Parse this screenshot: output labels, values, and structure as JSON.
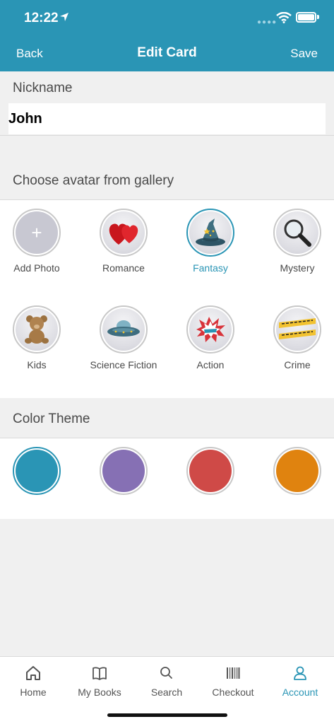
{
  "status_bar": {
    "time": "12:22"
  },
  "nav": {
    "back_label": "Back",
    "title": "Edit Card",
    "save_label": "Save"
  },
  "nickname": {
    "label": "Nickname",
    "value": "John"
  },
  "gallery": {
    "label": "Choose avatar from gallery",
    "items": [
      {
        "label": "Add Photo",
        "icon": "plus-icon"
      },
      {
        "label": "Romance",
        "icon": "hearts-icon"
      },
      {
        "label": "Fantasy",
        "icon": "wizard-hat-icon",
        "selected": true
      },
      {
        "label": "Mystery",
        "icon": "magnifier-icon"
      },
      {
        "label": "Kids",
        "icon": "teddy-bear-icon"
      },
      {
        "label": "Science Fiction",
        "icon": "ufo-icon"
      },
      {
        "label": "Action",
        "icon": "boom-icon"
      },
      {
        "label": "Crime",
        "icon": "crime-tape-icon"
      }
    ]
  },
  "color_theme": {
    "label": "Color Theme",
    "colors": [
      "#2a95b5",
      "#8670b4",
      "#cf4a47",
      "#e0830f"
    ],
    "selected_index": 0
  },
  "tabbar": {
    "tabs": [
      {
        "label": "Home",
        "icon": "home-icon"
      },
      {
        "label": "My Books",
        "icon": "book-icon"
      },
      {
        "label": "Search",
        "icon": "search-icon"
      },
      {
        "label": "Checkout",
        "icon": "barcode-icon"
      },
      {
        "label": "Account",
        "icon": "account-icon",
        "active": true
      }
    ]
  }
}
